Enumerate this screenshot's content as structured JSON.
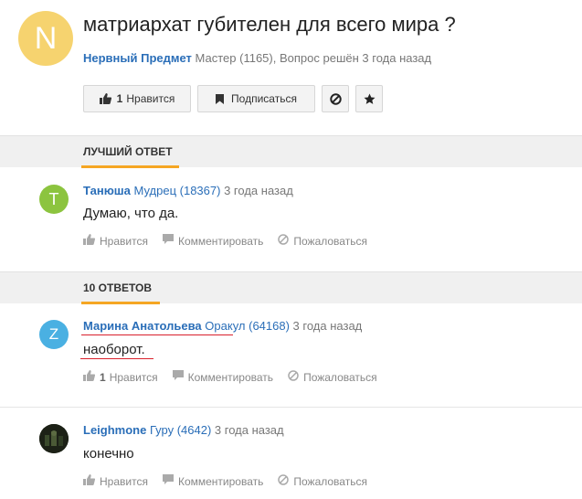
{
  "question": {
    "avatar_letter": "N",
    "avatar_color": "#f6d36f",
    "title": "матриархат губителен для всего мира ?",
    "author": "Нервный Предмет",
    "rank": "Мастер (1165)",
    "status": ", Вопрос решён 3 года назад",
    "like_count": "1",
    "like_label": "Нравится",
    "subscribe_label": "Подписаться"
  },
  "best_section": {
    "label": "ЛУЧШИЙ ОТВЕТ"
  },
  "answers_section": {
    "label": "10 ОТВЕТОВ"
  },
  "best_answer": {
    "avatar_letter": "T",
    "avatar_color": "#8cc43f",
    "author": "Танюша",
    "rank": "Мудрец (18367)",
    "time": "3 года назад",
    "text": "Думаю, что да.",
    "like_label": "Нравится",
    "comment_label": "Комментировать",
    "report_label": "Пожаловаться"
  },
  "answers": [
    {
      "avatar_letter": "Z",
      "avatar_color": "#4ab0e2",
      "author": "Марина Анатольева",
      "rank": "Оракул (64168)",
      "time": "3 года назад",
      "text": "наоборот.",
      "like_count": "1",
      "like_label": "Нравится",
      "comment_label": "Комментировать",
      "report_label": "Пожаловаться"
    },
    {
      "avatar_icon": "photo-avatar",
      "author": "Leighmone",
      "rank": "Гуру (4642)",
      "time": "3 года назад",
      "text": "конечно",
      "like_label": "Нравится",
      "comment_label": "Комментировать",
      "report_label": "Пожаловаться"
    }
  ],
  "colors": {
    "link": "#2a6eb8",
    "accent": "#f5a623",
    "annotation": "#d9202c"
  }
}
